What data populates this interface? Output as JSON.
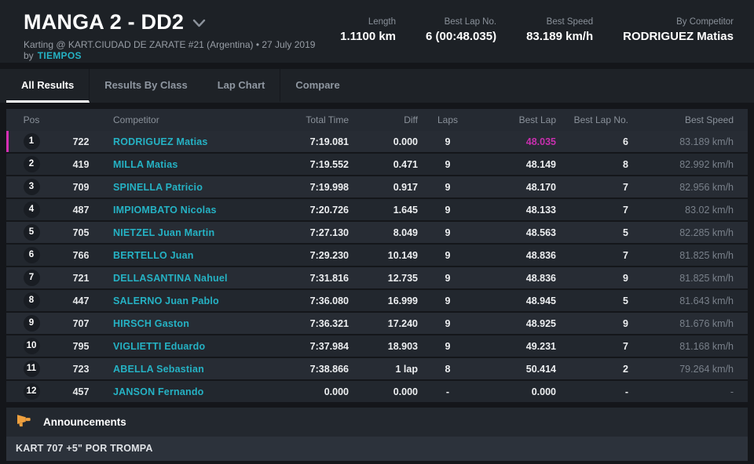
{
  "header": {
    "title": "MANGA 2 - DD2",
    "subtitle_text": "Karting @ KART.CIUDAD DE ZARATE #21 (Argentina) • 27 July 2019 by",
    "subtitle_link": "TIEMPOS",
    "stats": [
      {
        "label": "Length",
        "value": "1.1100 km"
      },
      {
        "label": "Best Lap No.",
        "value": "6 (00:48.035)"
      },
      {
        "label": "Best Speed",
        "value": "83.189 km/h"
      },
      {
        "label": "By Competitor",
        "value": "RODRIGUEZ Matias"
      }
    ]
  },
  "tabs": [
    {
      "label": "All Results",
      "active": true
    },
    {
      "label": "Results By Class",
      "active": false
    },
    {
      "label": "Lap Chart",
      "active": false
    },
    {
      "label": "Compare",
      "active": false
    }
  ],
  "table": {
    "columns": {
      "pos": "Pos",
      "kart": "",
      "competitor": "Competitor",
      "total_time": "Total Time",
      "diff": "Diff",
      "laps": "Laps",
      "best_lap": "Best Lap",
      "best_lap_no": "Best Lap No.",
      "best_speed": "Best Speed"
    },
    "rows": [
      {
        "pos": "1",
        "kart": "722",
        "competitor": "RODRIGUEZ Matias",
        "total_time": "7:19.081",
        "diff": "0.000",
        "laps": "9",
        "best_lap": "48.035",
        "best_lap_no": "6",
        "best_speed": "83.189 km/h",
        "highlight": true,
        "best_lap_is_best": true
      },
      {
        "pos": "2",
        "kart": "419",
        "competitor": "MILLA Matias",
        "total_time": "7:19.552",
        "diff": "0.471",
        "laps": "9",
        "best_lap": "48.149",
        "best_lap_no": "8",
        "best_speed": "82.992 km/h"
      },
      {
        "pos": "3",
        "kart": "709",
        "competitor": "SPINELLA Patricio",
        "total_time": "7:19.998",
        "diff": "0.917",
        "laps": "9",
        "best_lap": "48.170",
        "best_lap_no": "7",
        "best_speed": "82.956 km/h"
      },
      {
        "pos": "4",
        "kart": "487",
        "competitor": "IMPIOMBATO Nicolas",
        "total_time": "7:20.726",
        "diff": "1.645",
        "laps": "9",
        "best_lap": "48.133",
        "best_lap_no": "7",
        "best_speed": "83.02 km/h"
      },
      {
        "pos": "5",
        "kart": "705",
        "competitor": "NIETZEL Juan Martin",
        "total_time": "7:27.130",
        "diff": "8.049",
        "laps": "9",
        "best_lap": "48.563",
        "best_lap_no": "5",
        "best_speed": "82.285 km/h"
      },
      {
        "pos": "6",
        "kart": "766",
        "competitor": "BERTELLO Juan",
        "total_time": "7:29.230",
        "diff": "10.149",
        "laps": "9",
        "best_lap": "48.836",
        "best_lap_no": "7",
        "best_speed": "81.825 km/h"
      },
      {
        "pos": "7",
        "kart": "721",
        "competitor": "DELLASANTINA Nahuel",
        "total_time": "7:31.816",
        "diff": "12.735",
        "laps": "9",
        "best_lap": "48.836",
        "best_lap_no": "9",
        "best_speed": "81.825 km/h"
      },
      {
        "pos": "8",
        "kart": "447",
        "competitor": "SALERNO Juan Pablo",
        "total_time": "7:36.080",
        "diff": "16.999",
        "laps": "9",
        "best_lap": "48.945",
        "best_lap_no": "5",
        "best_speed": "81.643 km/h"
      },
      {
        "pos": "9",
        "kart": "707",
        "competitor": "HIRSCH Gaston",
        "total_time": "7:36.321",
        "diff": "17.240",
        "laps": "9",
        "best_lap": "48.925",
        "best_lap_no": "9",
        "best_speed": "81.676 km/h"
      },
      {
        "pos": "10",
        "kart": "795",
        "competitor": "VIGLIETTI Eduardo",
        "total_time": "7:37.984",
        "diff": "18.903",
        "laps": "9",
        "best_lap": "49.231",
        "best_lap_no": "7",
        "best_speed": "81.168 km/h"
      },
      {
        "pos": "11",
        "kart": "723",
        "competitor": "ABELLA Sebastian",
        "total_time": "7:38.866",
        "diff": "1 lap",
        "laps": "8",
        "best_lap": "50.414",
        "best_lap_no": "2",
        "best_speed": "79.264 km/h"
      },
      {
        "pos": "12",
        "kart": "457",
        "competitor": "JANSON Fernando",
        "total_time": "0.000",
        "diff": "0.000",
        "laps": "-",
        "best_lap": "0.000",
        "best_lap_no": "-",
        "best_speed": "-"
      }
    ]
  },
  "announcements": {
    "title": "Announcements",
    "items": [
      "KART 707 +5\" POR TROMPA"
    ]
  },
  "colors": {
    "accent_cyan": "#25b2c4",
    "accent_magenta": "#d52fb4",
    "accent_orange": "#efa03e"
  }
}
